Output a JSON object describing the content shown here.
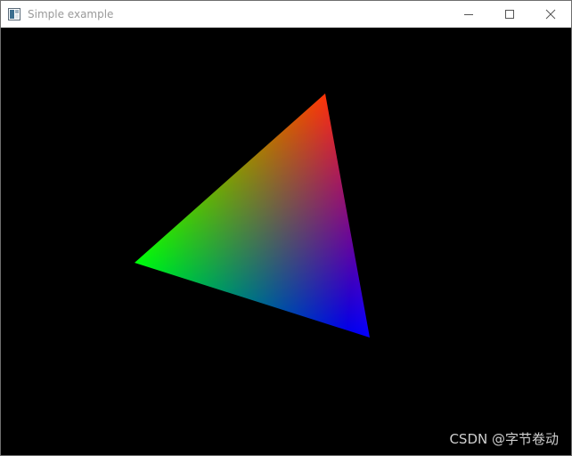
{
  "window": {
    "title": "Simple example",
    "controls": {
      "minimize_icon": "minimize-icon",
      "maximize_icon": "maximize-icon",
      "close_icon": "close-icon"
    }
  },
  "scene": {
    "background": "#000000",
    "triangle": {
      "vertex_colors": [
        "#ff0000",
        "#00ff00",
        "#0000ff"
      ]
    }
  },
  "watermark": {
    "text": "CSDN @字节卷动"
  }
}
